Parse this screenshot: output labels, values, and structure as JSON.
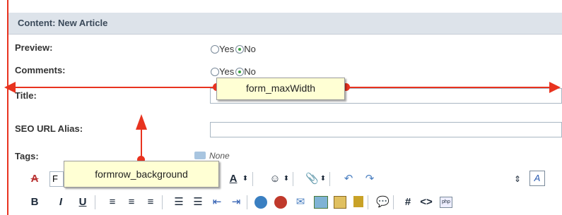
{
  "panel": {
    "title": "Content: New Article"
  },
  "form": {
    "preview": {
      "label": "Preview:",
      "options": [
        "Yes",
        "No"
      ],
      "selected": "No"
    },
    "comments": {
      "label": "Comments:",
      "options": [
        "Yes",
        "No"
      ],
      "selected": "No"
    },
    "title": {
      "label": "Title:",
      "value": ""
    },
    "seo": {
      "label": "SEO URL Alias:",
      "value": ""
    },
    "tags": {
      "label": "Tags:",
      "value": "None"
    }
  },
  "callouts": {
    "maxwidth": "form_maxWidth",
    "rowbg": "formrow_background"
  },
  "toolbar": {
    "row1": {
      "format_icon": "A",
      "font_select_value": "F",
      "font_color": "A",
      "emoticon": "☺",
      "attach": "📎",
      "undo": "↶",
      "redo": "↷",
      "resize": "⇕",
      "spellcheck": "A"
    },
    "row2": {
      "bold": "B",
      "italic": "I",
      "underline": "U",
      "hash": "#",
      "code": "<>"
    }
  },
  "colors": {
    "annotation": "#e8331f",
    "callout_bg": "#ffffd4",
    "header_bg": "#dde3ea"
  }
}
